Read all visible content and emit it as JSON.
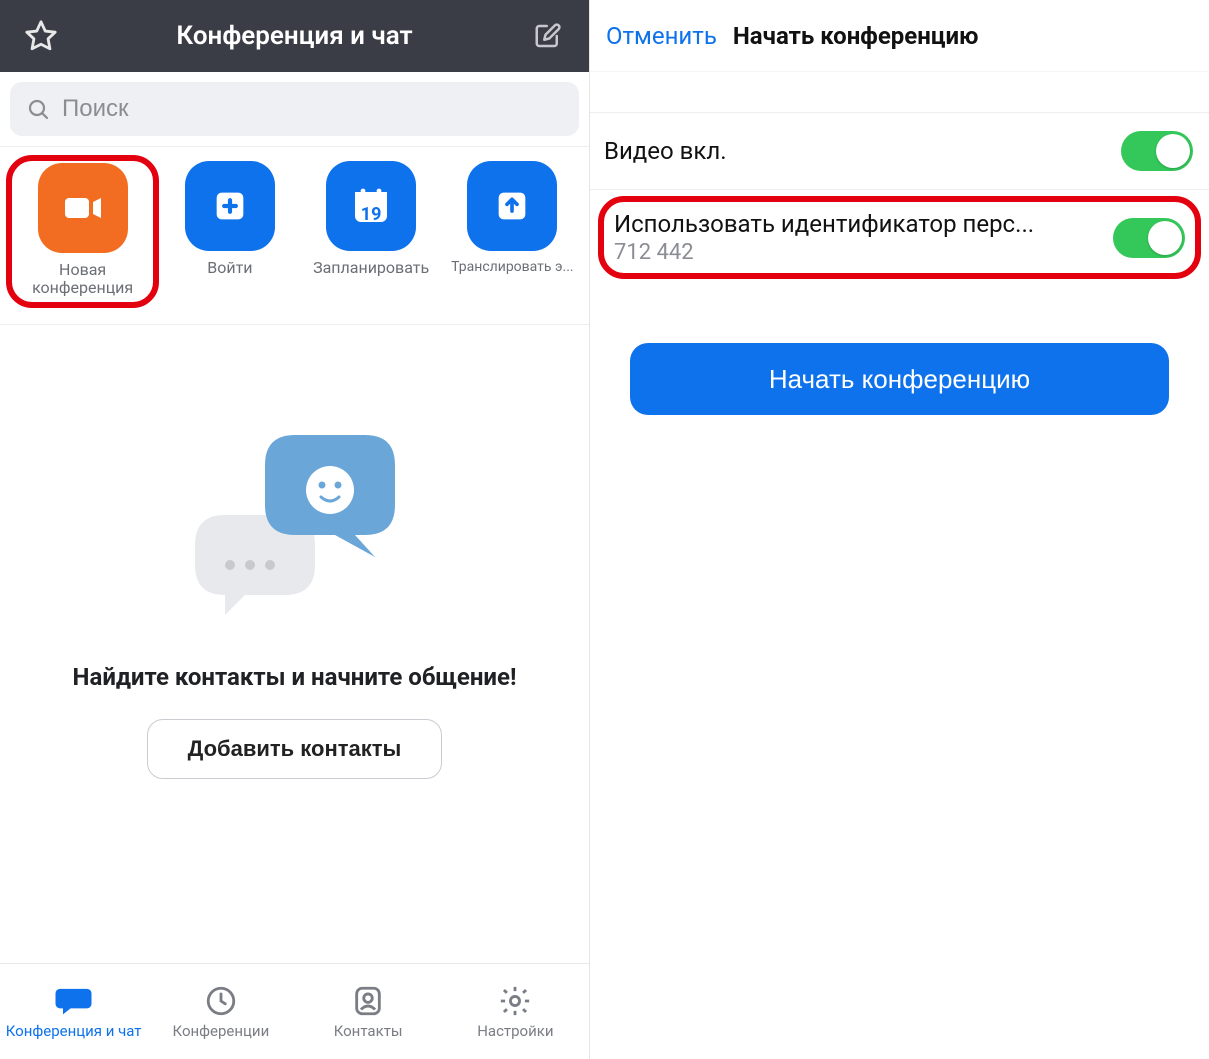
{
  "left": {
    "header_title": "Конференция и чат",
    "search_placeholder": "Поиск",
    "actions": {
      "new_meeting": "Новая конференция",
      "join": "Войти",
      "schedule": "Запланировать",
      "schedule_day": "19",
      "share": "Транслировать э..."
    },
    "empty": {
      "headline": "Найдите контакты и начните общение!",
      "add_contacts": "Добавить контакты"
    },
    "tabs": {
      "chat": "Конференция и чат",
      "meetings": "Конференции",
      "contacts": "Контакты",
      "settings": "Настройки"
    }
  },
  "right": {
    "cancel": "Отменить",
    "title": "Начать конференцию",
    "video_on_label": "Видео вкл.",
    "pmi_label": "Использовать идентификатор перс...",
    "pmi_value": "712 442",
    "start_button": "Начать конференцию"
  }
}
